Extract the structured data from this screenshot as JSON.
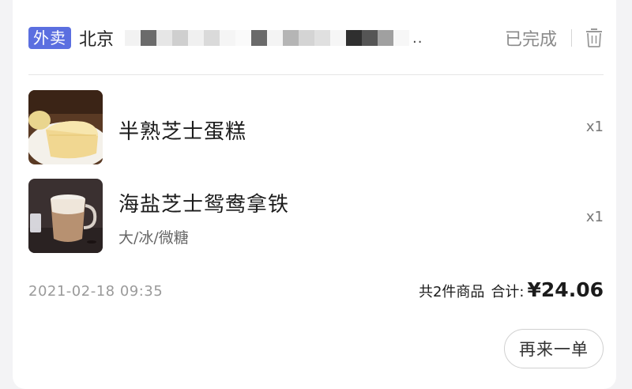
{
  "order": {
    "type_tag": "外卖",
    "address_prefix": "北京",
    "address_ellipsis": "..",
    "status": "已完成"
  },
  "items": [
    {
      "name": "半熟芝士蛋糕",
      "spec": "",
      "qty": "x1"
    },
    {
      "name": "海盐芝士鸳鸯拿铁",
      "spec": "大/冰/微糖",
      "qty": "x1"
    }
  ],
  "footer": {
    "datetime": "2021-02-18 09:35",
    "count_text": "共2件商品",
    "total_label": "合计:",
    "total_price": "¥24.06",
    "reorder_label": "再来一单"
  },
  "colors": {
    "tag_bg": "#5b6fe0",
    "status": "#8a8a8a"
  },
  "icons": {
    "delete": "trash-icon"
  }
}
